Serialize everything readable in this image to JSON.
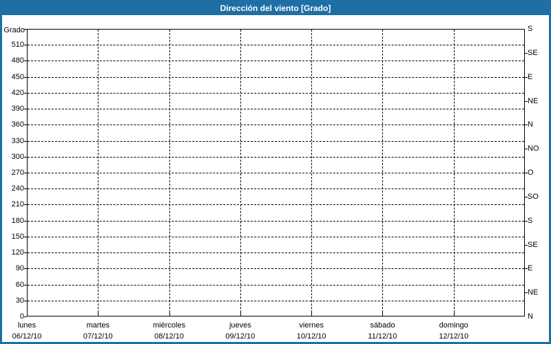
{
  "header": {
    "title": "Dirección del viento [Grado]"
  },
  "colors": {
    "frame": "#1d6fa5",
    "titlebar_bg": "#1d6fa5",
    "titlebar_text": "#ffffff",
    "plot_border": "#000000",
    "grid": "#000000",
    "label_text": "#000000",
    "background": "#ffffff"
  },
  "chart_data": {
    "type": "line",
    "title": "Dirección del viento [Grado]",
    "ylabel": "Grado",
    "ylim": [
      0,
      540
    ],
    "ytick_step": 30,
    "ytick_labels": [
      "0",
      "30",
      "60",
      "90",
      "120",
      "150",
      "180",
      "210",
      "240",
      "270",
      "300",
      "330",
      "360",
      "390",
      "420",
      "450",
      "480",
      "510"
    ],
    "right_axis_step": 45,
    "right_axis_labels_bottom_to_top": [
      "N",
      "NE",
      "E",
      "SE",
      "S",
      "SO",
      "O",
      "NO",
      "N",
      "NE",
      "E",
      "SE",
      "S"
    ],
    "x_categories": [
      {
        "day": "lunes",
        "date": "06/12/10"
      },
      {
        "day": "martes",
        "date": "07/12/10"
      },
      {
        "day": "miércoles",
        "date": "08/12/10"
      },
      {
        "day": "jueves",
        "date": "09/12/10"
      },
      {
        "day": "viernes",
        "date": "10/12/10"
      },
      {
        "day": "sábado",
        "date": "11/12/10"
      },
      {
        "day": "domingo",
        "date": "12/12/10"
      }
    ],
    "grid": "dashed horizontal lines every 30 degrees, dashed vertical lines at day boundaries",
    "legend": "none",
    "series": []
  }
}
